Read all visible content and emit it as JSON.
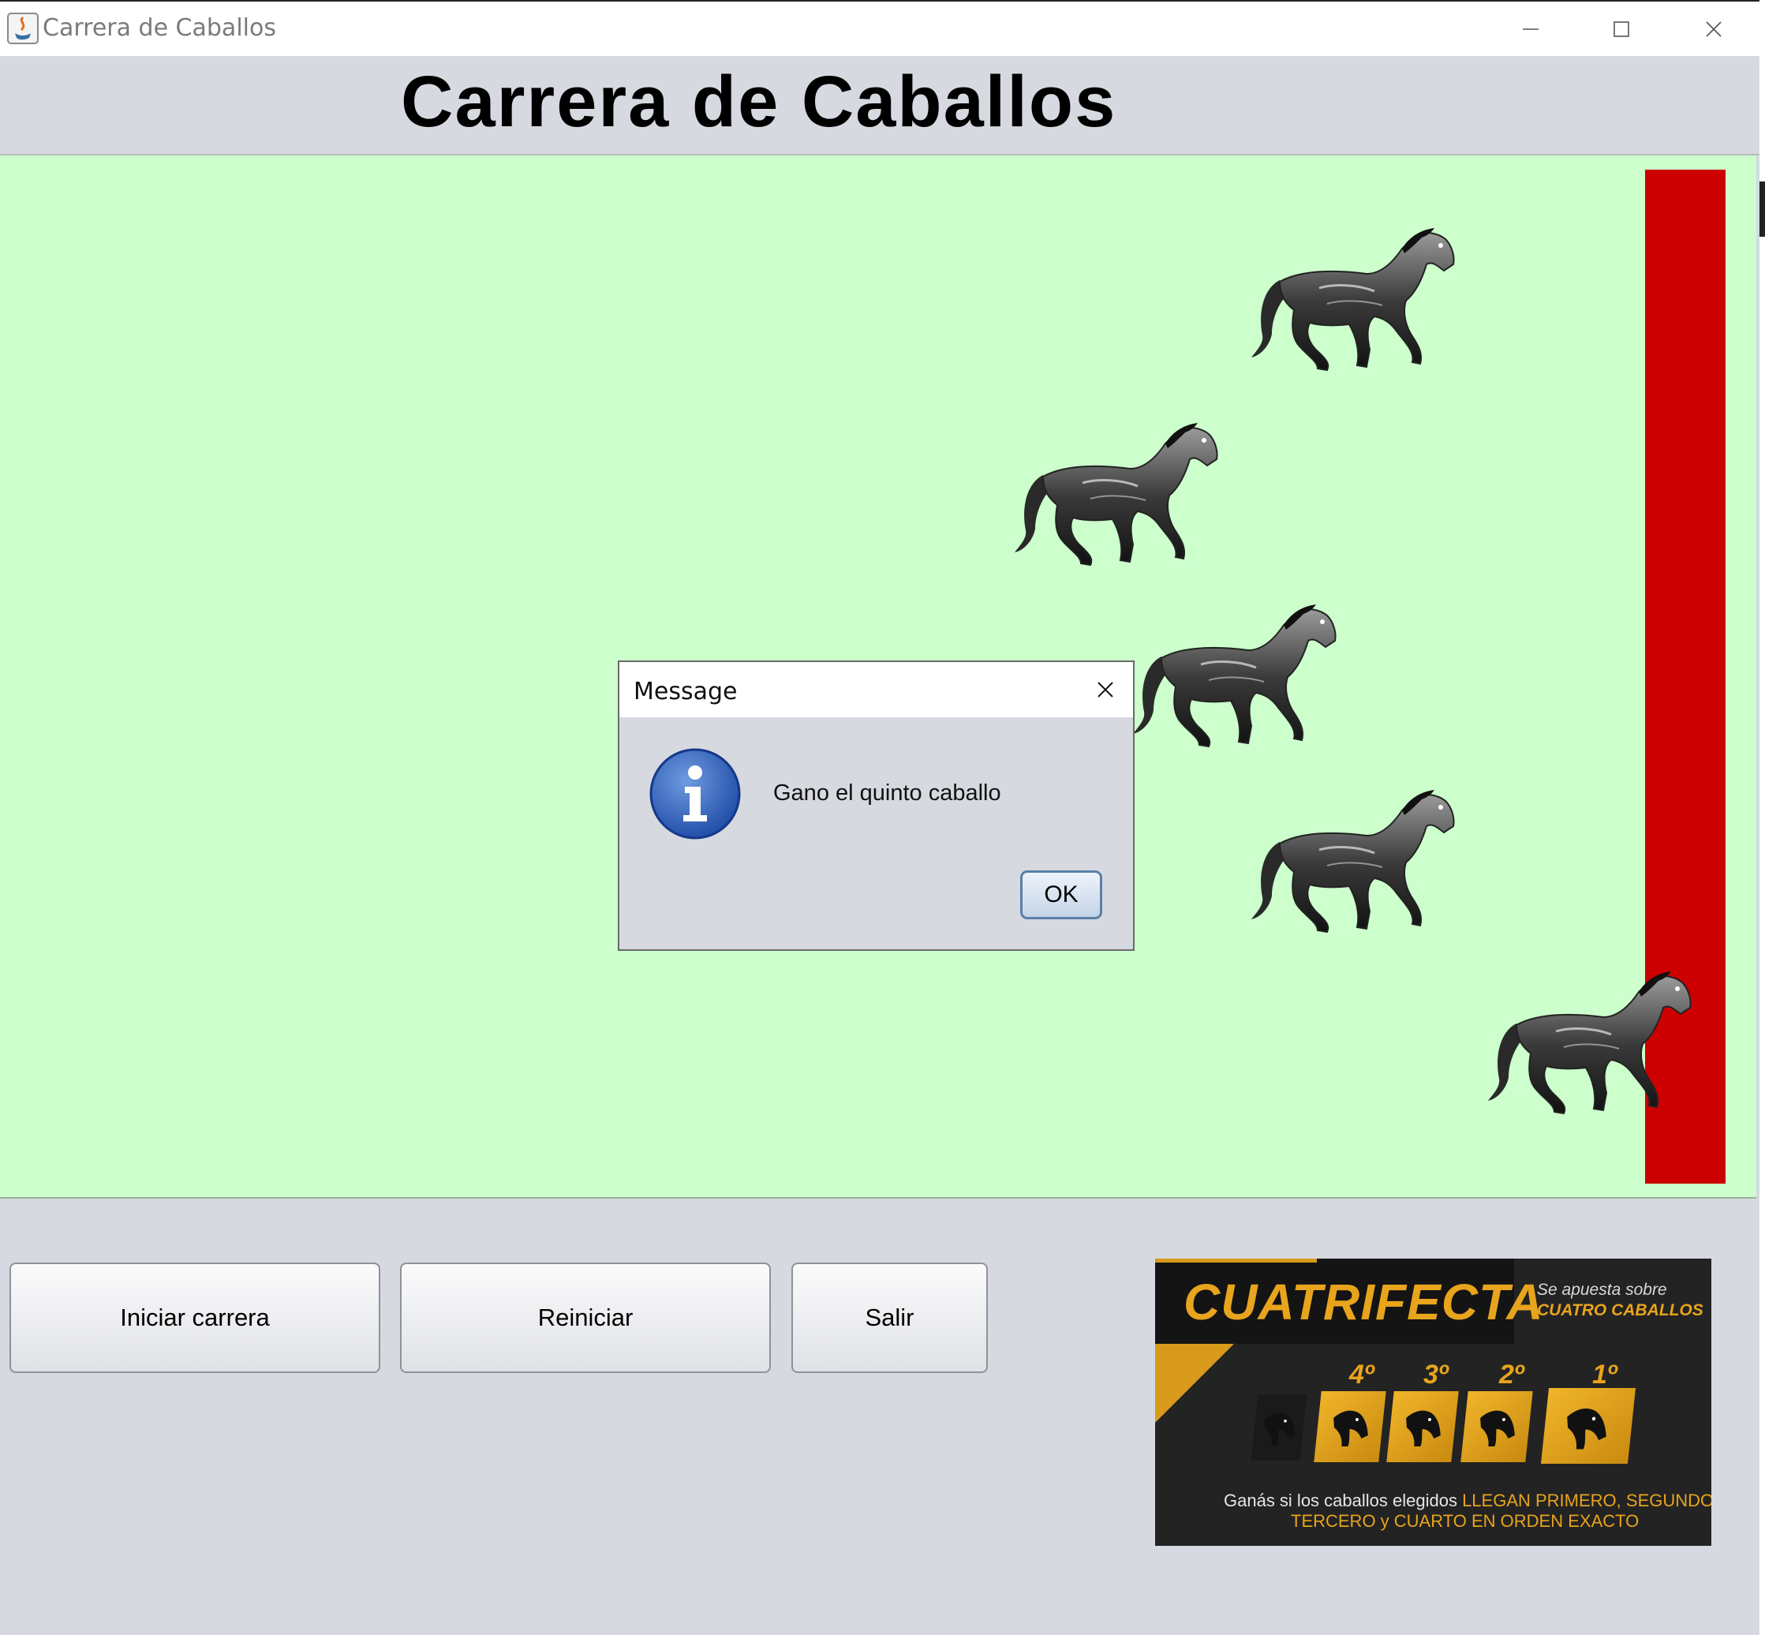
{
  "window": {
    "title": "Carrera de Caballos",
    "controls": [
      "minimize-icon",
      "maximize-icon",
      "close-icon"
    ]
  },
  "header": {
    "title": "Carrera de Caballos"
  },
  "track": {
    "background": "#ccffcc",
    "finish_line_color": "#cc0000",
    "horses": 5
  },
  "dialog": {
    "title": "Message",
    "message": "Gano el quinto caballo",
    "ok_label": "OK",
    "icon": "info-icon"
  },
  "controls": {
    "start_label": "Iniciar carrera",
    "restart_label": "Reiniciar",
    "exit_label": "Salir"
  },
  "banner": {
    "title": "CUATRIFECTA",
    "subtitle_line1": "Se apuesta sobre",
    "subtitle_line2": "CUATRO CABALLOS",
    "positions": [
      "4º",
      "3º",
      "2º",
      "1º"
    ],
    "footer_white": "Ganás si los caballos elegidos ",
    "footer_gold1": "LLEGAN PRIMERO, SEGUNDO",
    "footer_gold2": "TERCERO y CUARTO EN ORDEN EXACTO"
  }
}
